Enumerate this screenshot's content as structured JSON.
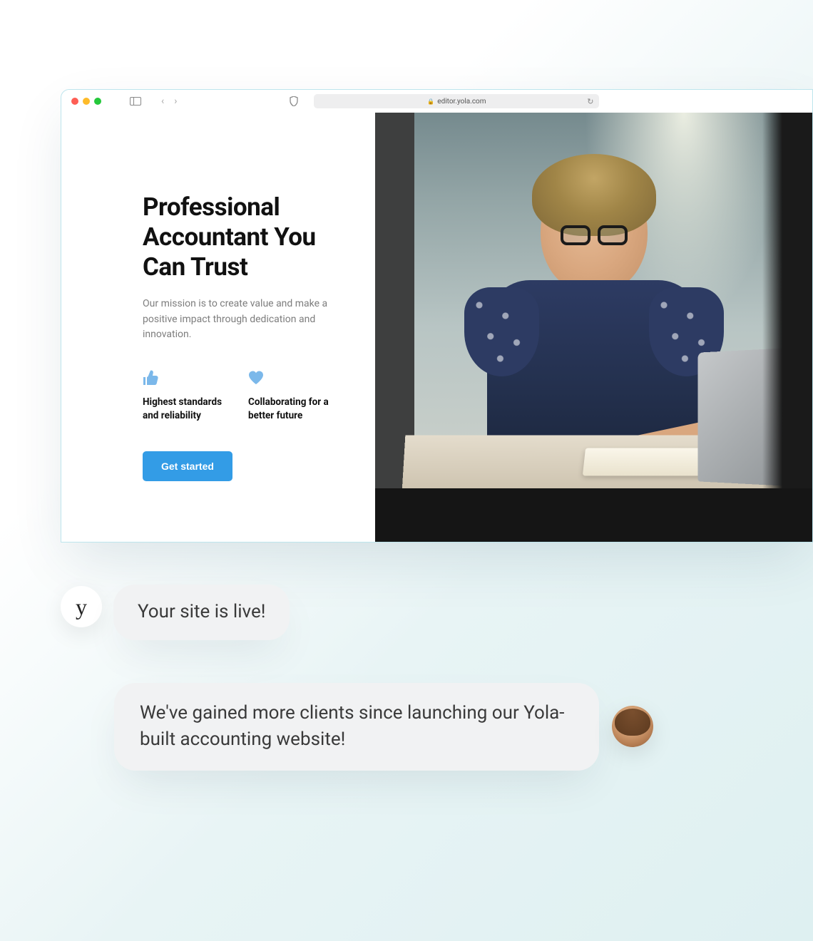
{
  "browser": {
    "url": "editor.yola.com"
  },
  "website": {
    "hero": {
      "heading": "Professional Accountant You Can Trust",
      "body": "Our mission is to create value and make a positive impact through dedication and innovation."
    },
    "features": [
      {
        "icon": "thumbs-up-icon",
        "title": "Highest standards and reliability"
      },
      {
        "icon": "heart-icon",
        "title": "Collaborating for a better future"
      }
    ],
    "cta": "Get started"
  },
  "chat": {
    "yola_avatar": "y",
    "bubble1": "Your site is live!",
    "bubble2": "We've gained more clients since launching our Yola-built accounting website!"
  },
  "colors": {
    "accent": "#339ce6",
    "icon_blue": "#7bb8ea"
  }
}
